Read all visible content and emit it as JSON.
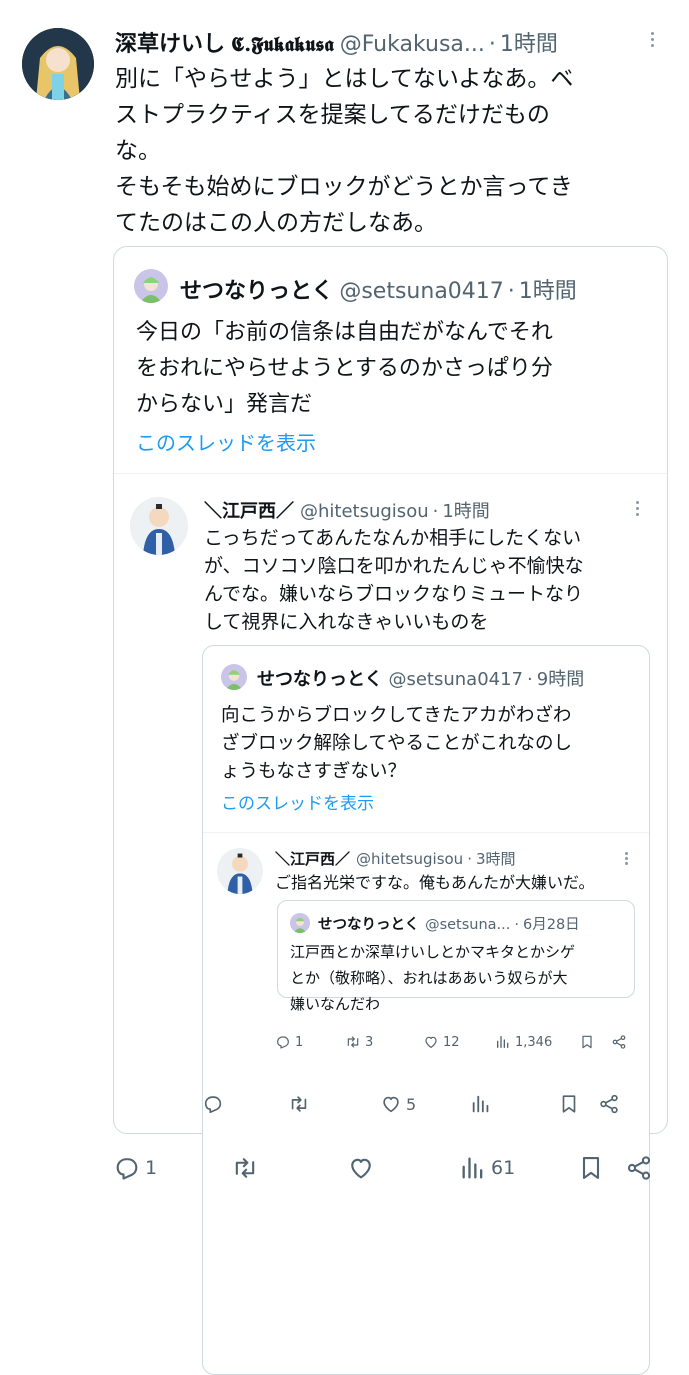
{
  "main": {
    "name": "深草けいし",
    "name_logo": "𝕮.𝕱𝖚𝖐𝖆𝖐𝖚𝖘𝖆",
    "handle": "@Fukakusa...",
    "time": "1時間",
    "text": "別に「やらせよう」とはしてないよなあ。ベ\nストプラクティスを提案してるだけだもの\nな。\nそもそも始めにブロックがどうとか言ってき\nてたのはこの人の方だしなあ。",
    "stats": {
      "replies": "1",
      "retweets": "",
      "likes": "",
      "views": "61"
    }
  },
  "quote1": {
    "name": "せつなりっとく",
    "handle": "@setsuna0417",
    "time": "1時間",
    "text": "今日の「お前の信条は自由だがなんでそれ\nをおれにやらせようとするのかさっぱり分\nからない」発言だ",
    "show_thread": "このスレッドを表示"
  },
  "reply1": {
    "name": "＼江戸西／",
    "handle": "@hitetsugisou",
    "time": "1時間",
    "text": "こっちだってあんたなんか相手にしたくない\nが、コソコソ陰口を叩かれたんじゃ不愉快な\nんでな。嫌いならブロックなりミュートなり\nして視界に入れなきゃいいものを",
    "stats": {
      "replies": "",
      "retweets": "",
      "likes": "5",
      "views": ""
    }
  },
  "quote2": {
    "name": "せつなりっとく",
    "handle": "@setsuna0417",
    "time": "9時間",
    "text": "向こうからブロックしてきたアカがわざわ\nざブロック解除してやることがこれなのし\nょうもなさすぎない？",
    "show_thread": "このスレッドを表示"
  },
  "reply2": {
    "name": "＼江戸西／",
    "handle": "@hitetsugisou",
    "time": "3時間",
    "text": "ご指名光栄ですな。俺もあんたが大嫌いだ。",
    "stats": {
      "replies": "1",
      "retweets": "3",
      "likes": "12",
      "views": "1,346"
    }
  },
  "quote3": {
    "name": "せつなりっとく",
    "handle": "@setsuna...",
    "time": "6月28日",
    "text": "江戸西とか深草けいしとかマキタとかシゲ\nとか（敬称略）、おれはああいう奴らが大\n嫌いなんだわ"
  },
  "separator": "·",
  "colors": {
    "link": "#1d9bf0",
    "muted": "#536471",
    "border": "#cfd9de",
    "text": "#0f1419"
  }
}
